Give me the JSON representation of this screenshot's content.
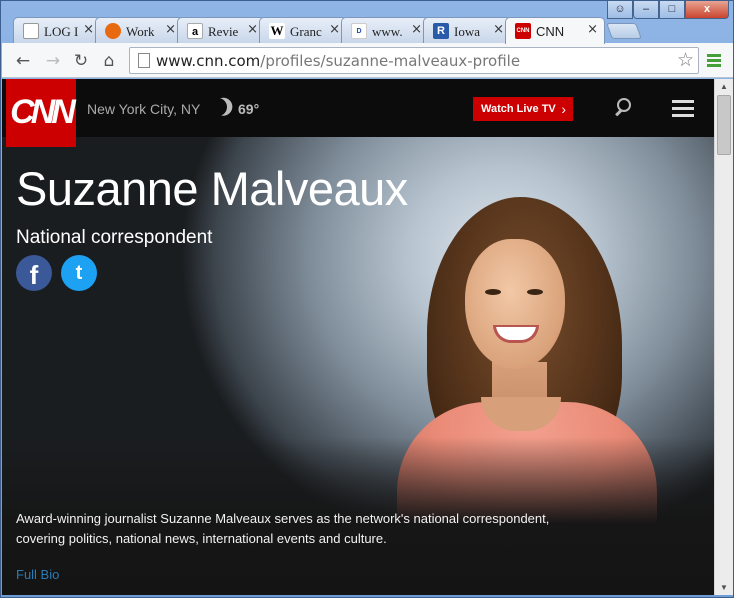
{
  "browser": {
    "tabs": [
      {
        "label": "LOG I",
        "icon": "document-icon",
        "fav_color": "#ffffff"
      },
      {
        "label": "Work",
        "icon": "work-icon",
        "fav_color": "#e86a10"
      },
      {
        "label": "Revie",
        "icon": "amazon-icon",
        "fav_color": "#ffffff"
      },
      {
        "label": "Granc",
        "icon": "wikipedia-icon",
        "fav_color": "#ffffff"
      },
      {
        "label": "www.",
        "icon": "disney-icon",
        "fav_color": "#ffffff"
      },
      {
        "label": "Iowa",
        "icon": "register-icon",
        "fav_color": "#2a5ba8"
      },
      {
        "label": "CNN",
        "icon": "cnn-icon",
        "fav_color": "#cc0000"
      }
    ],
    "active_tab": 6,
    "url_domain": "www.cnn.com",
    "url_path": "/profiles/suzanne-malveaux-profile",
    "window_controls": {
      "close": "x",
      "min": "–",
      "max": "□"
    }
  },
  "cnn": {
    "logo": "CNN",
    "location": "New York City, NY",
    "temperature": "69°",
    "watch_live": "Watch Live TV",
    "brand_red": "#cc0000"
  },
  "profile": {
    "name": "Suzanne Malveaux",
    "title": "National correspondent",
    "facebook_glyph": "f",
    "twitter_glyph": "t",
    "bio": "Award-winning journalist Suzanne Malveaux serves as the network's national correspondent, covering politics, national news, international events and culture.",
    "full_bio_link": "Full Bio",
    "link_color": "#2a7ab5"
  }
}
